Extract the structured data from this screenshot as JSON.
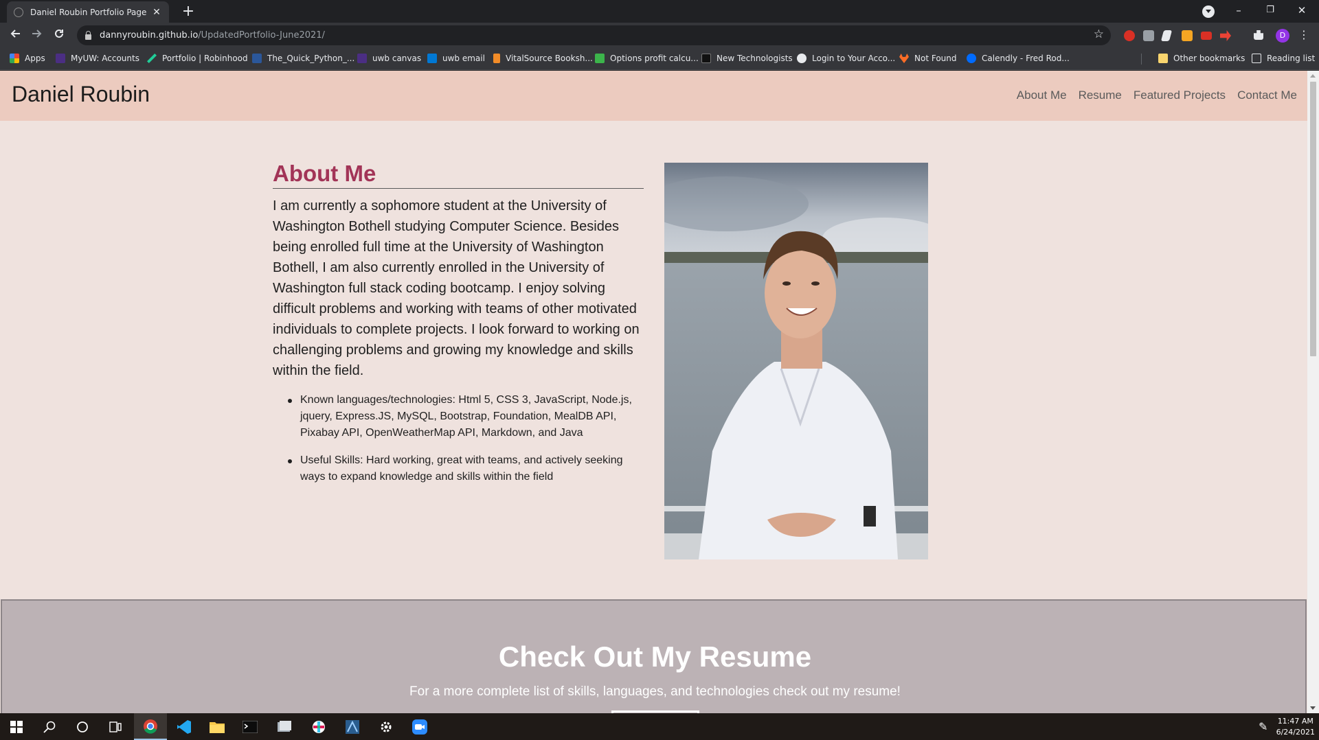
{
  "browser": {
    "tab_title": "Daniel Roubin Portfolio Page",
    "tab_close": "✕",
    "new_tab": "+",
    "window_controls": {
      "minimize": "–",
      "restore": "❐",
      "close": "✕"
    },
    "url_host": "dannyroubin.github.io",
    "url_path": "/UpdatedPortfolio-June2021/",
    "profile_initial": "D"
  },
  "bookmarks": [
    {
      "label": "Apps",
      "icon": "apps-grid-icon",
      "color": "#ea4335"
    },
    {
      "label": "MyUW: Accounts",
      "icon": "myuw-icon",
      "color": "#4b2e83"
    },
    {
      "label": "Portfolio | Robinhood",
      "icon": "robinhood-feather-icon",
      "color": "#21ce99"
    },
    {
      "label": "The_Quick_Python_...",
      "icon": "word-icon",
      "color": "#2b579a"
    },
    {
      "label": "uwb canvas",
      "icon": "uw-icon",
      "color": "#4b2e83"
    },
    {
      "label": "uwb email",
      "icon": "outlook-icon",
      "color": "#0078d4"
    },
    {
      "label": "VitalSource Booksh...",
      "icon": "vitalsource-icon",
      "color": "#f28c28"
    },
    {
      "label": "Options profit calcu...",
      "icon": "options-calc-icon",
      "color": "#3cb44b"
    },
    {
      "label": "New Technologists",
      "icon": "newtech-icon",
      "color": "#111111"
    },
    {
      "label": "Login to Your Acco...",
      "icon": "globe-icon",
      "color": "#e8eaed"
    },
    {
      "label": "Not Found",
      "icon": "gitlab-icon",
      "color": "#fc6d26"
    },
    {
      "label": "Calendly - Fred Rod...",
      "icon": "calendly-icon",
      "color": "#006bff"
    },
    {
      "label": "Other bookmarks",
      "icon": "folder-icon",
      "color": "#f9d56e"
    },
    {
      "label": "Reading list",
      "icon": "reading-list-icon",
      "color": "#e8eaed"
    }
  ],
  "site": {
    "brand": "Daniel Roubin",
    "nav": [
      "About Me",
      "Resume",
      "Featured Projects",
      "Contact Me"
    ],
    "about": {
      "heading": "About Me",
      "paragraph": "I am currently a sophomore student at the University of Washington Bothell studying Computer Science. Besides being enrolled full time at the University of Washington Bothell, I am also currently enrolled in the University of Washington full stack coding bootcamp. I enjoy solving difficult problems and working with teams of other motivated individuals to complete projects. I look forward to working on challenging problems and growing my knowledge and skills within the field.",
      "bullets": [
        "Known languages/technologies: Html 5, CSS 3, JavaScript, Node.js, jquery, Express.JS, MySQL, Bootstrap, Foundation, MealDB API, Pixabay API, OpenWeatherMap API, Markdown, and Java",
        "Useful Skills: Hard working, great with teams, and actively seeking ways to expand knowledge and skills within the field"
      ]
    },
    "resume": {
      "heading": "Check Out My Resume",
      "subheading": "For a more complete list of skills, languages, and technologies check out my resume!"
    },
    "colors": {
      "nav_bg": "#eccbbf",
      "page_bg": "#efe2de",
      "accent": "#a23457",
      "resume_bg": "#bcb2b5"
    }
  },
  "taskbar": {
    "time": "11:47 AM",
    "date": "6/24/2021",
    "apps": [
      "windows-start-icon",
      "search-icon",
      "cortana-icon",
      "task-view-icon",
      "chrome-icon",
      "vscode-icon",
      "file-explorer-icon",
      "terminal-icon",
      "mysql-workbench-icon",
      "slack-icon",
      "app-icon",
      "settings-gear-icon",
      "zoom-icon"
    ]
  }
}
